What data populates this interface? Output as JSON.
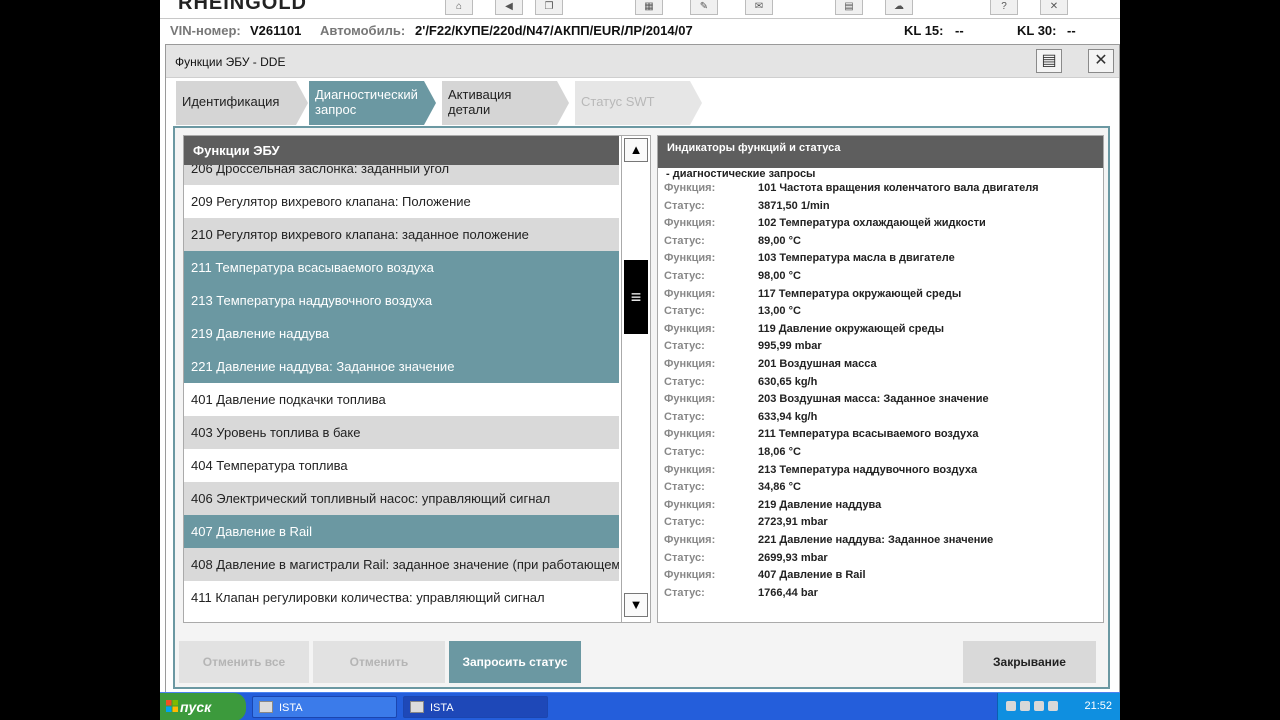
{
  "app": {
    "brand": "RHEINGOLD"
  },
  "vehicle": {
    "vin_label": "VIN-номер:",
    "vin_value": "V261101",
    "car_label": "Автомобиль:",
    "car_value": "2'/F22/КУПЕ/220d/N47/АКПП/EUR/ЛР/2014/07",
    "kl15_label": "KL 15:",
    "kl15_value": "--",
    "kl30_label": "KL 30:",
    "kl30_value": "--"
  },
  "dialog": {
    "title": "Функции ЭБУ - DDE",
    "tabs": [
      {
        "label": "Идентификация"
      },
      {
        "label": "Диагностический запрос"
      },
      {
        "label": "Активация детали"
      },
      {
        "label": "Статус SWT"
      }
    ],
    "list_header": "Функции ЭБУ",
    "list_items": [
      {
        "label": "206 Дроссельная заслонка: заданный угол"
      },
      {
        "label": "209 Регулятор вихревого клапана: Положение"
      },
      {
        "label": "210 Регулятор вихревого клапана: заданное положение"
      },
      {
        "label": "211 Температура всасываемого воздуха"
      },
      {
        "label": "213 Температура наддувочного воздуха"
      },
      {
        "label": "219 Давление наддува"
      },
      {
        "label": "221 Давление наддува: Заданное значение"
      },
      {
        "label": "401 Давление подкачки топлива"
      },
      {
        "label": "403 Уровень топлива в баке"
      },
      {
        "label": "404 Температура топлива"
      },
      {
        "label": "406 Электрический топливный насос: управляющий сигнал"
      },
      {
        "label": "407 Давление в Rail"
      },
      {
        "label": "408 Давление в магистрали Rail: заданное значение (при работающем"
      },
      {
        "label": "411 Клапан регулировки количества: управляющий сигнал"
      }
    ],
    "status_header": "Индикаторы функций и статуса",
    "status_section": "- диагностические запросы",
    "status_lines": [
      {
        "key": "Функция:",
        "value": "101 Частота вращения коленчатого вала двигателя"
      },
      {
        "key": "Статус:",
        "value": "3871,50  1/min"
      },
      {
        "key": "Функция:",
        "value": "102 Температура охлаждающей жидкости"
      },
      {
        "key": "Статус:",
        "value": "89,00  °C"
      },
      {
        "key": "Функция:",
        "value": "103 Температура масла в двигателе"
      },
      {
        "key": "Статус:",
        "value": "98,00  °C"
      },
      {
        "key": "Функция:",
        "value": "117 Температура окружающей среды"
      },
      {
        "key": "Статус:",
        "value": "13,00  °C"
      },
      {
        "key": "Функция:",
        "value": "119 Давление окружающей среды"
      },
      {
        "key": "Статус:",
        "value": "995,99  mbar"
      },
      {
        "key": "Функция:",
        "value": "201 Воздушная масса"
      },
      {
        "key": "Статус:",
        "value": "630,65  kg/h"
      },
      {
        "key": "Функция:",
        "value": "203 Воздушная масса: Заданное значение"
      },
      {
        "key": "Статус:",
        "value": "633,94  kg/h"
      },
      {
        "key": "Функция:",
        "value": "211 Температура всасываемого воздуха"
      },
      {
        "key": "Статус:",
        "value": "18,06  °C"
      },
      {
        "key": "Функция:",
        "value": "213 Температура наддувочного воздуха"
      },
      {
        "key": "Статус:",
        "value": "34,86  °C"
      },
      {
        "key": "Функция:",
        "value": "219 Давление наддува"
      },
      {
        "key": "Статус:",
        "value": "2723,91  mbar"
      },
      {
        "key": "Функция:",
        "value": "221 Давление наддува: Заданное значение"
      },
      {
        "key": "Статус:",
        "value": "2699,93  mbar"
      },
      {
        "key": "Функция:",
        "value": "407 Давление в Rail"
      },
      {
        "key": "Статус:",
        "value": "1766,44  bar"
      }
    ],
    "buttons": {
      "cancel_all": "Отменить все",
      "cancel": "Отменить",
      "request_status": "Запросить статус",
      "close": "Закрывание"
    }
  },
  "taskbar": {
    "start_label": "пуск",
    "tasks": [
      {
        "label": "ISTA"
      },
      {
        "label": "ISTA"
      }
    ],
    "clock": "21:52"
  },
  "colors": {
    "accent": "#6b98a2",
    "header": "#5e5e5e",
    "taskbar": "#245edb",
    "start": "#3c9a3c"
  }
}
